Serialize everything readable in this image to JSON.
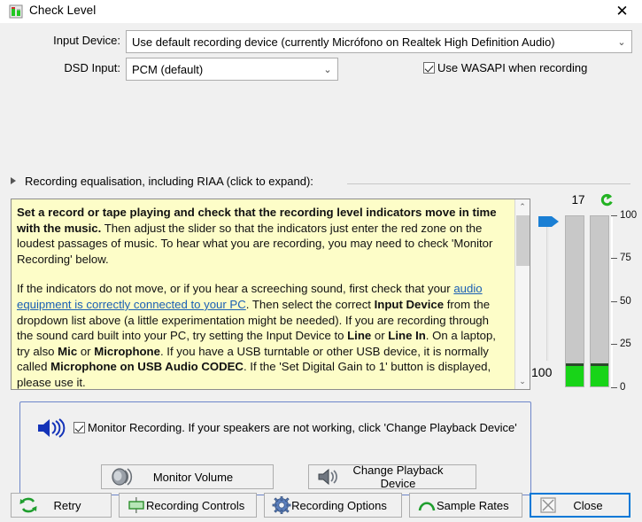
{
  "window": {
    "title": "Check Level",
    "title_icon": "level-meter-icon",
    "close_glyph": "✕"
  },
  "form": {
    "input_device_label": "Input Device:",
    "input_device_value": "Use default recording device (currently Micrófono on Realtek High Definition Audio)",
    "dsd_input_label": "DSD Input:",
    "dsd_input_value": "PCM (default)",
    "combo_arrow": "⌄",
    "wasapi_label": "Use WASAPI when recording",
    "wasapi_checked": true
  },
  "expander": {
    "label": "Recording equalisation, including RIAA (click to expand):",
    "expanded": false
  },
  "info": {
    "p1_bold": "Set a record or tape playing and check that the recording level indicators move in time with the music.",
    "p1_rest": "  Then adjust the slider so that the indicators just enter the red zone on the loudest passages of music.  To hear what you are recording, you may need to check 'Monitor Recording' below.",
    "p2_a": "If the indicators do not move, or if you hear a screeching sound, first check that your ",
    "p2_link": "audio equipment is correctly connected to your PC",
    "p2_b": ".  Then select the correct ",
    "p2_bold1": "Input Device",
    "p2_c": " from the dropdown list above (a little experimentation might be needed).  If you are recording through the sound card built into your PC, try setting the Input Device to ",
    "p2_bold2": "Line",
    "p2_d": " or ",
    "p2_bold3": "Line In",
    "p2_e": ".  On a laptop, try also ",
    "p2_bold4": "Mic",
    "p2_f": " or ",
    "p2_bold5": "Microphone",
    "p2_g": ".  If you have a USB turntable or other USB device, it is normally called ",
    "p2_bold6": "Microphone on USB Audio CODEC",
    "p2_h": ".  If the 'Set Digital Gain to 1' button is displayed, please use it.",
    "scroll_up_glyph": "⌃",
    "scroll_down_glyph": "⌄",
    "background_color": "#fdfdc8",
    "link_color": "#1a5fb4"
  },
  "meters": {
    "gain_value": "17",
    "slider_bottom_label": "100",
    "refresh_icon": "refresh-icon",
    "scale_labels": [
      "100",
      "75",
      "50",
      "25",
      "0"
    ],
    "scale_max": 100,
    "scale_min": 0,
    "left_level": 12,
    "right_level": 12,
    "fill_color": "#18d418",
    "track_color": "#c8c8c8",
    "peak_color": "#2c4a2c",
    "slider_color": "#1a7fd4",
    "slider_position_percent": 94
  },
  "monitor": {
    "speaker_icon": "speaker-icon",
    "checkbox_label": "Monitor Recording.  If your speakers are not working, click 'Change Playback Device'",
    "checkbox_checked": true,
    "monitor_volume_label": "Monitor Volume",
    "monitor_volume_icon": "volume-knob-icon",
    "change_playback_label": "Change Playback Device",
    "change_playback_icon": "speaker-small-icon",
    "border_color": "#6d86c9"
  },
  "buttons": [
    {
      "id": "retry",
      "label": "Retry",
      "icon": "refresh-arrows-icon",
      "focused": false
    },
    {
      "id": "recording-controls",
      "label": "Recording Controls",
      "icon": "fader-icon",
      "focused": false
    },
    {
      "id": "recording-options",
      "label": "Recording Options",
      "icon": "gear-icon",
      "focused": false
    },
    {
      "id": "sample-rates",
      "label": "Sample Rates",
      "icon": "arc-icon",
      "focused": false
    },
    {
      "id": "close",
      "label": "Close",
      "icon": "close-box-icon",
      "focused": true
    }
  ]
}
